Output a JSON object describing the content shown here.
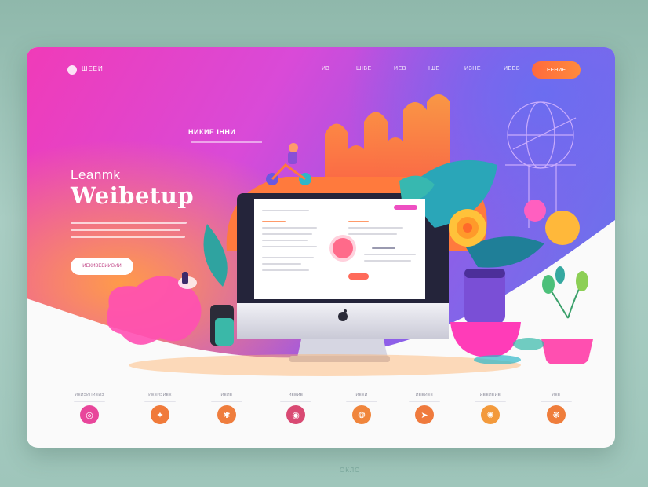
{
  "nav": {
    "logo": "ШЕЕИ",
    "links": [
      "ИЗ",
      "ШІВЕ",
      "ИЕВ",
      "ІШЕ",
      "ИЗНЕ",
      "ИЕЕВ"
    ],
    "cta": "ЕЕНИЕ"
  },
  "hero": {
    "kicker": "НИКИЕ ІННИ",
    "eyebrow": "Leanmk",
    "headline": "Weibetup",
    "button": "ИЕКИВЕЕИИВИИ"
  },
  "features": [
    {
      "label": "ИЕИЗИНИЕИЗ",
      "icon": "target-icon",
      "color": "#e8469b",
      "glyph": "◎"
    },
    {
      "label": "ИЕЕИЗИЕЕ",
      "icon": "chart-icon",
      "color": "#f07a3a",
      "glyph": "✦"
    },
    {
      "label": "ИЕИЕ",
      "icon": "gear-icon",
      "color": "#ef7d3d",
      "glyph": "✱"
    },
    {
      "label": "ИЕЕИЕ",
      "icon": "globe-icon",
      "color": "#d94a73",
      "glyph": "◉"
    },
    {
      "label": "ИЕЕИ",
      "icon": "star-icon",
      "color": "#f0853c",
      "glyph": "❂"
    },
    {
      "label": "ИЕЕИЕЕ",
      "icon": "rocket-icon",
      "color": "#ef7a3d",
      "glyph": "➤"
    },
    {
      "label": "ИЕЕИЕИЕ",
      "icon": "bulb-icon",
      "color": "#f39a3c",
      "glyph": "✺"
    },
    {
      "label": "ИЕЕ",
      "icon": "heart-icon",
      "color": "#ef7d3b",
      "glyph": "❋"
    }
  ],
  "footer": {
    "mark": "ОКЛС"
  }
}
